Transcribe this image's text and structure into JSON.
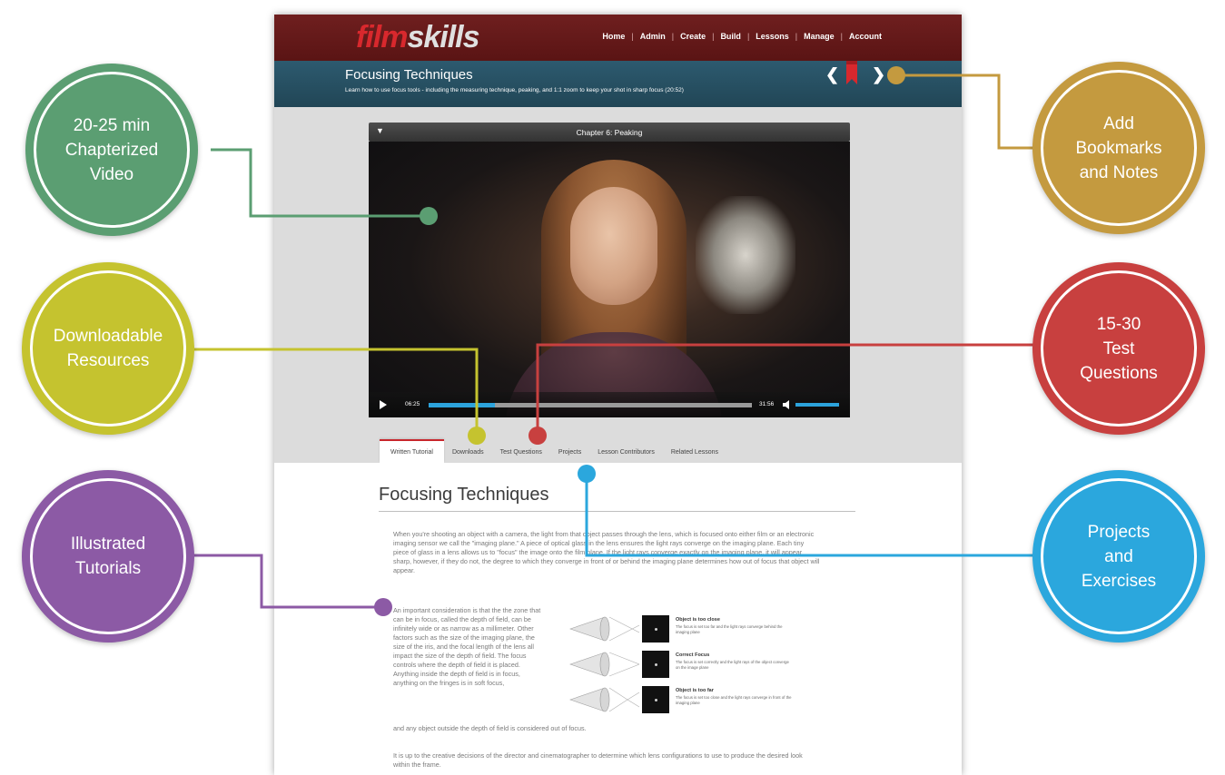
{
  "app": {
    "logo_part1": "film",
    "logo_part2": "skills"
  },
  "nav": {
    "items": [
      {
        "label": "Home"
      },
      {
        "label": "Admin"
      },
      {
        "label": "Create"
      },
      {
        "label": "Build"
      },
      {
        "label": "Lessons"
      },
      {
        "label": "Manage"
      },
      {
        "label": "Account"
      }
    ],
    "separator": "|"
  },
  "lesson": {
    "title": "Focusing Techniques",
    "subtitle": "Learn how to use focus tools - including the measuring technique, peaking, and 1:1 zoom to keep your shot in sharp focus (20:52)",
    "prev_glyph": "❮",
    "next_glyph": "❯",
    "bookmark_icon": "bookmark-icon"
  },
  "player": {
    "chapter_toggle": "▼",
    "chapter_title": "Chapter 6: Peaking",
    "current_time": "06:25",
    "duration": "31:56",
    "progress_fraction": 0.205,
    "volume_fraction": 1.0
  },
  "tabs": [
    {
      "label": "Written Tutorial",
      "active": true
    },
    {
      "label": "Downloads",
      "active": false
    },
    {
      "label": "Test Questions",
      "active": false
    },
    {
      "label": "Projects",
      "active": false
    },
    {
      "label": "Lesson Contributors",
      "active": false
    },
    {
      "label": "Related Lessons",
      "active": false
    }
  ],
  "article": {
    "title": "Focusing Techniques",
    "p1": "When you're shooting an object with a camera, the light from that object passes through the lens, which is focused onto either film or an electronic imaging sensor we call the \"imaging plane.\" A piece of optical glass in the lens ensures the light rays converge on the imaging plane. Each tiny piece of glass in a lens allows us to \"focus\" the image onto the film plane. If the light rays converge exactly on the imaging plane, it will appear sharp, however, if they do not, the degree to which they converge in front of or behind the imaging plane determines how out of focus that object will appear.",
    "p2": "An important consideration is that the the zone that can be in focus, called the depth of field, can be infinitely wide or as narrow as a millimeter.  Other factors such as the size of the imaging plane, the size of the iris, and the focal length of the lens all impact the size of the depth of field. The focus controls where the depth of field it is placed. Anything inside the depth of field is in focus, anything on the fringes is in soft focus,",
    "p2_end": "and any object outside the depth of field is considered out of focus.",
    "p3": "It is up to the creative decisions of the director and cinematographer to determine which lens configurations to use to produce the desired look within the frame.",
    "diagram": [
      {
        "heading": "Object is too close",
        "desc": "The focus is set too far and the light rays converge behind the imaging plane"
      },
      {
        "heading": "Correct Focus",
        "desc": "The focus is set correctly and the light rays of the object converge on the image plane"
      },
      {
        "heading": "Object is too far",
        "desc": "The focus is set too close and the light rays converge in front of the imaging plane"
      }
    ]
  },
  "callouts": {
    "video": {
      "text": "20-25 min\nChapterized\nVideo",
      "color": "#5b9e72"
    },
    "resources": {
      "text": "Downloadable\nResources",
      "color": "#c5c32f"
    },
    "tutorials": {
      "text": "Illustrated\nTutorials",
      "color": "#8c5aa5"
    },
    "bookmarks": {
      "text": "Add\nBookmarks\nand Notes",
      "color": "#c49a3f"
    },
    "questions": {
      "text": "15-30\nTest\nQuestions",
      "color": "#c8403f"
    },
    "projects": {
      "text": "Projects\nand\nExercises",
      "color": "#2ba7dd"
    }
  },
  "colors": {
    "nav_bg": "#5a1414",
    "lesson_bar_bg": "#244b5c",
    "accent_red": "#d8282d",
    "progress_blue": "#2ca3dc"
  }
}
